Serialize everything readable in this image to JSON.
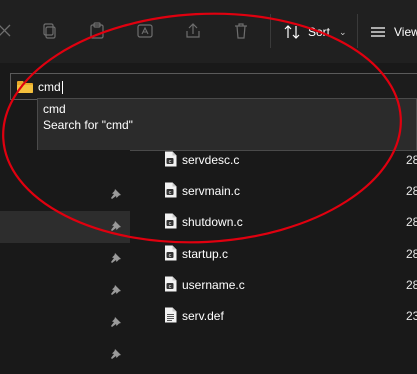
{
  "toolbar": {
    "sort_label": "Sort",
    "view_label": "View",
    "chevron": "⌄",
    "disabled_icons": [
      "cut-icon",
      "copy-icon",
      "paste-icon",
      "rename-icon",
      "share-icon",
      "delete-icon"
    ]
  },
  "address_bar": {
    "value": "cmd",
    "icon": "folder-icon"
  },
  "autocomplete": {
    "items": [
      "cmd",
      "Search for \"cmd\""
    ]
  },
  "navigation": {
    "pin_icon": "pin-icon"
  },
  "files": [
    {
      "name": "servdesc.c",
      "date": "28",
      "icon": "c-source-file-icon"
    },
    {
      "name": "servmain.c",
      "date": "28",
      "icon": "c-source-file-icon"
    },
    {
      "name": "shutdown.c",
      "date": "28",
      "icon": "c-source-file-icon"
    },
    {
      "name": "startup.c",
      "date": "28",
      "icon": "c-source-file-icon"
    },
    {
      "name": "username.c",
      "date": "28",
      "icon": "c-source-file-icon"
    },
    {
      "name": "serv.def",
      "date": "23",
      "icon": "def-file-icon"
    }
  ],
  "colors": {
    "window_bg": "#191919",
    "toolbar_bg": "#202020",
    "annotation": "#e0000f",
    "folder": "#f4c03d",
    "selected_row": "#2d2d2d"
  }
}
